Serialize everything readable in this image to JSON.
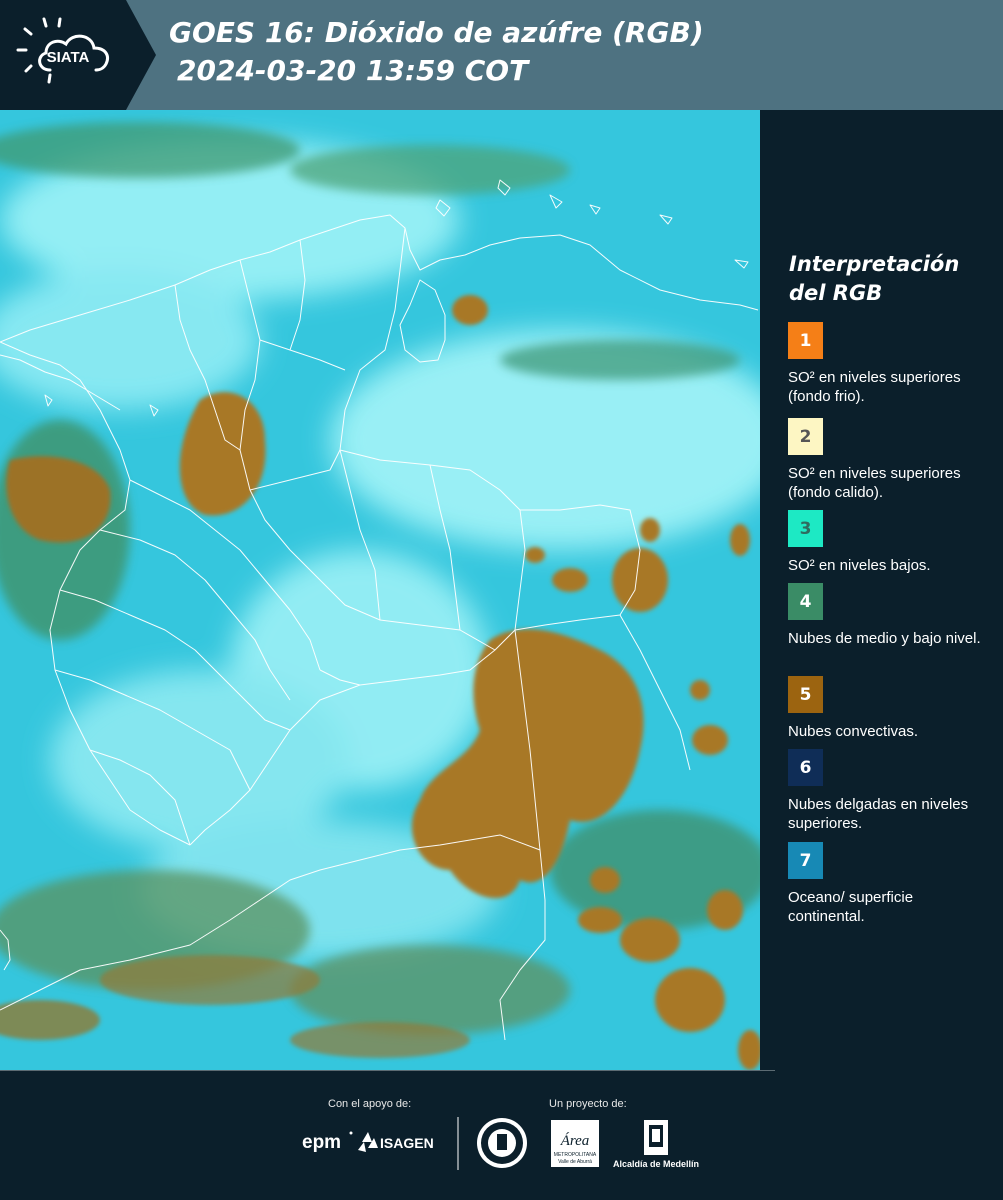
{
  "header": {
    "logo_text": "SIATA",
    "title_line1": "GOES 16: Dióxido de azúfre (RGB)",
    "title_line2": "2024-03-20 13:59 COT"
  },
  "legend": {
    "title": "Interpretación del RGB",
    "items": [
      {
        "number": "1",
        "description": "SO² en niveles superiores (fondo frio).",
        "color": "#f57f17",
        "text_color": "#ffffff"
      },
      {
        "number": "2",
        "description": "SO² en niveles superiores (fondo calido).",
        "color": "#fdf6c3",
        "text_color": "#555555"
      },
      {
        "number": "3",
        "description": "SO² en niveles bajos.",
        "color": "#1de9c4",
        "text_color": "#2f6b5f"
      },
      {
        "number": "4",
        "description": "Nubes de medio y bajo nivel.",
        "color": "#3a8c66",
        "text_color": "#ffffff"
      },
      {
        "number": "5",
        "description": "Nubes convectivas.",
        "color": "#9c6410",
        "text_color": "#ffffff"
      },
      {
        "number": "6",
        "description": "Nubes delgadas en niveles superiores.",
        "color": "#0f2d57",
        "text_color": "#ffffff"
      },
      {
        "number": "7",
        "description": "Oceano/ superficie continental.",
        "color": "#1789b5",
        "text_color": "#ffffff"
      }
    ]
  },
  "footer": {
    "support_label": "Con el apoyo de:",
    "project_label": "Un proyecto de:",
    "logo_epm": "epm",
    "logo_isagen": "ISAGEN",
    "logo_area": "Área",
    "logo_area_sub": "METROPOLITANA",
    "logo_area_sub2": "Valle de Aburrá",
    "logo_alcaldia": "Alcaldía de Medellín"
  },
  "colors": {
    "header_bg": "#4e7281",
    "logo_bg": "#0b1f2b",
    "map_sky": "#7de8f2",
    "convective": "#a87825"
  }
}
